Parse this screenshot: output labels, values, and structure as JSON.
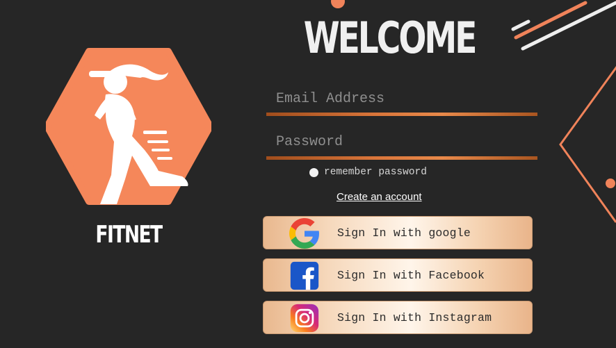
{
  "colors": {
    "background": "#262626",
    "accent": "#f0835a",
    "field_underline": "#d9753a"
  },
  "brand": {
    "name": "FITNET",
    "logo_icon": "runner-hexagon-icon"
  },
  "header": {
    "title": "WELCOME"
  },
  "form": {
    "email": {
      "placeholder": "Email Address",
      "value": ""
    },
    "password": {
      "placeholder": "Password",
      "value": ""
    },
    "remember": {
      "label": "remember password",
      "checked": false
    },
    "create_account": "Create an account"
  },
  "social_buttons": [
    {
      "label": "Sign In with google",
      "icon": "google-icon"
    },
    {
      "label": "Sign In with Facebook",
      "icon": "facebook-icon"
    },
    {
      "label": "Sign In with Instagram",
      "icon": "instagram-icon"
    }
  ]
}
